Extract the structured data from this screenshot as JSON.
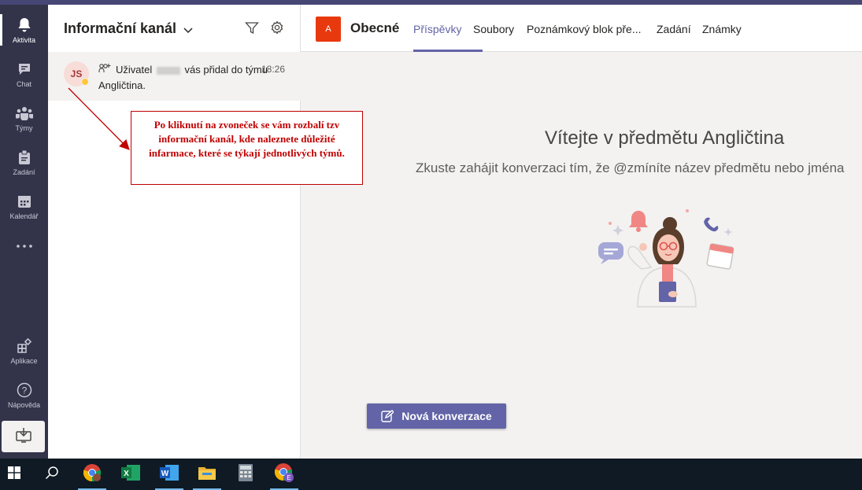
{
  "rail": {
    "items": [
      {
        "label": "Aktivita",
        "icon": "bell-icon"
      },
      {
        "label": "Chat",
        "icon": "chat-icon"
      },
      {
        "label": "Týmy",
        "icon": "teams-icon"
      },
      {
        "label": "Zadání",
        "icon": "assignments-icon"
      },
      {
        "label": "Kalendář",
        "icon": "calendar-icon"
      },
      {
        "label": "",
        "icon": "more-icon"
      },
      {
        "label": "Aplikace",
        "icon": "apps-icon"
      },
      {
        "label": "Nápověda",
        "icon": "help-icon"
      }
    ]
  },
  "panel": {
    "title": "Informační kanál"
  },
  "feed": {
    "initials": "JS",
    "text_before": "Uživatel",
    "text_after": "vás přidal do týmu Angličtina.",
    "time": "18:26"
  },
  "annotation": {
    "text": "Po kliknutí na zvoneček se vám rozbalí tzv informační kanál, kde naleznete důležité infarmace, které se týkají jednotlivých týmů."
  },
  "header": {
    "team_initial": "A",
    "channel": "Obecné",
    "tabs": [
      "Příspěvky",
      "Soubory",
      "Poznámkový blok pře...",
      "Zadání",
      "Známky"
    ]
  },
  "main": {
    "welcome_title": "Vítejte v předmětu Angličtina",
    "welcome_sub": "Zkuste zahájit konverzaci tím, že @zmíníte název předmětu nebo jména",
    "new_conversation": "Nová konverzace"
  },
  "colors": {
    "rail": "#33344a",
    "accent": "#6264a7",
    "team_tile": "#e8390e",
    "annotation": "#c00000"
  }
}
